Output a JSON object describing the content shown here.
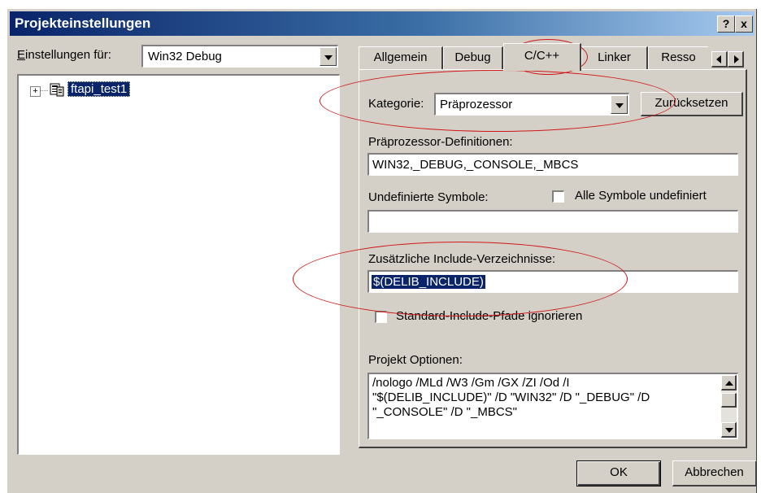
{
  "window": {
    "title": "Projekteinstellungen",
    "help_label": "?",
    "close_label": "x"
  },
  "left": {
    "settings_for_label": "Einstellungen für:",
    "config_value": "Win32 Debug",
    "tree_item": "ftapi_test1",
    "expand_symbol": "+"
  },
  "tabs": [
    "Allgemein",
    "Debug",
    "C/C++",
    "Linker",
    "Resso"
  ],
  "active_tab": "C/C++",
  "right": {
    "category_label": "Kategorie:",
    "category_value": "Präprozessor",
    "reset_button": "Zurücksetzen",
    "preproc_defs_label": "Präprozessor-Definitionen:",
    "preproc_defs_value": "WIN32,_DEBUG,_CONSOLE,_MBCS",
    "undef_symbols_label": "Undefinierte Symbole:",
    "undef_symbols_value": "",
    "all_undef_label": "Alle Symbole undefiniert",
    "include_dirs_label": "Zusätzliche Include-Verzeichnisse:",
    "include_dirs_value": "$(DELIB_INCLUDE)",
    "ignore_std_label": "Standard-Include-Pfade ignorieren",
    "options_label": "Projekt Optionen:",
    "options_lines": [
      "/nologo /MLd /W3 /Gm /GX /ZI /Od /I",
      "\"$(DELIB_INCLUDE)\" /D \"WIN32\" /D \"_DEBUG\" /D",
      "\"_CONSOLE\" /D \"_MBCS\""
    ]
  },
  "buttons": {
    "ok": "OK",
    "cancel": "Abbrechen"
  },
  "colors": {
    "annotation": "#d01818",
    "selection": "#0a246a",
    "face": "#d4d0c8"
  }
}
